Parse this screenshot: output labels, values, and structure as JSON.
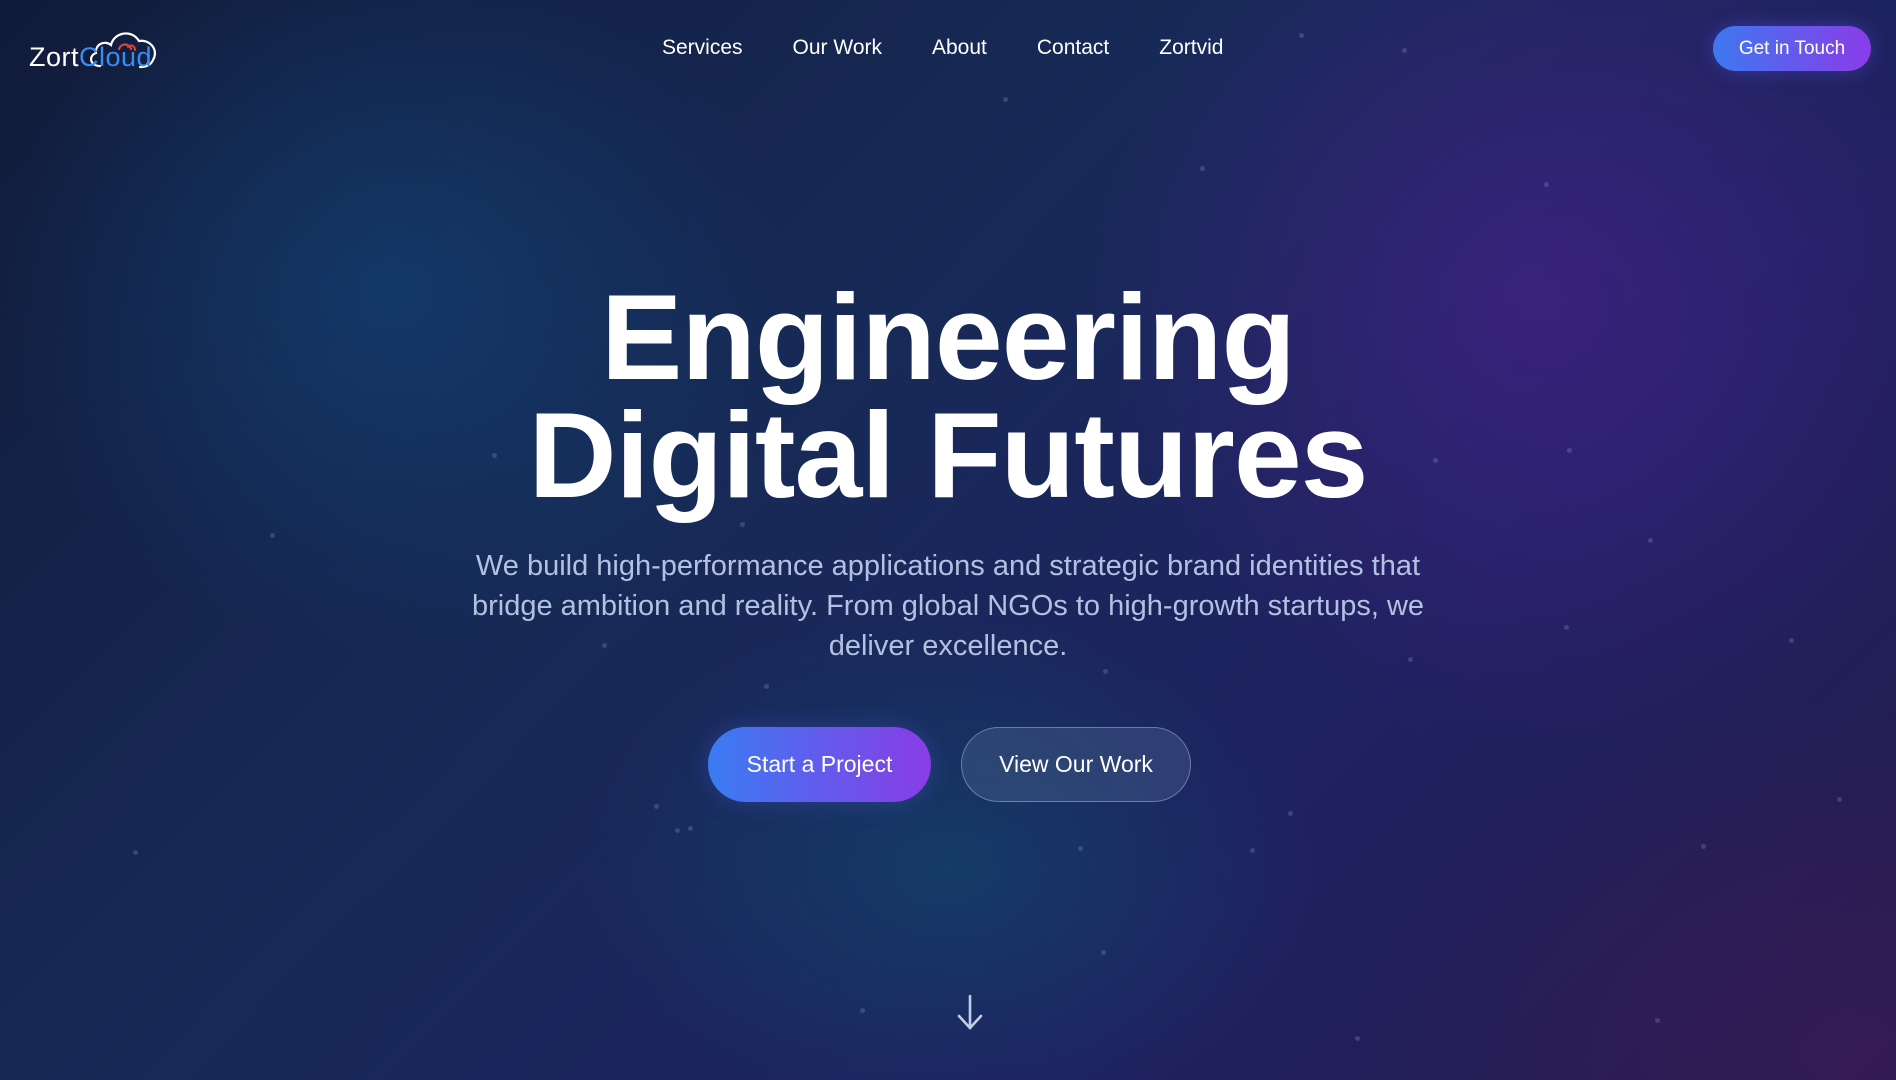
{
  "header": {
    "logo": {
      "text_part1": "Zort",
      "text_part2": "Cloud",
      "icon": "cloud-icon"
    },
    "nav": [
      {
        "label": "Services"
      },
      {
        "label": "Our Work"
      },
      {
        "label": "About"
      },
      {
        "label": "Contact"
      },
      {
        "label": "Zortvid"
      }
    ],
    "cta_label": "Get in Touch"
  },
  "hero": {
    "title_line1": "Engineering",
    "title_line2": "Digital Futures",
    "subtitle": "We build high-performance applications and strategic brand identities that bridge ambition and reality. From global NGOs to high-growth startups, we deliver excellence.",
    "primary_button": "Start a Project",
    "secondary_button": "View Our Work",
    "scroll_icon": "arrow-down-icon"
  },
  "colors": {
    "accent_start": "#3d78f0",
    "accent_end": "#8a3ce8",
    "logo_blue": "#3b8cf0",
    "logo_red": "#e0413a",
    "subtitle_text": "#b3c1e0"
  }
}
